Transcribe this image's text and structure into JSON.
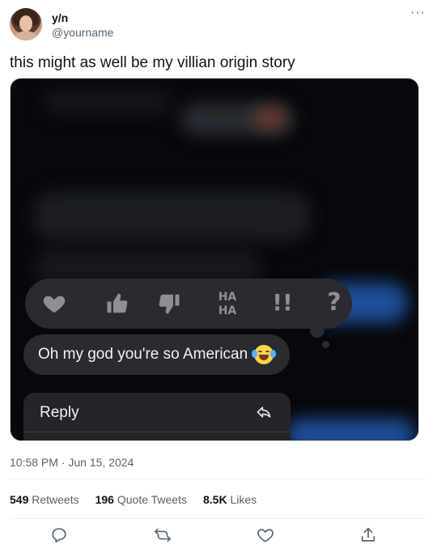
{
  "header": {
    "display_name": "y/n",
    "handle": "@yourname",
    "more_label": "···"
  },
  "tweet": {
    "text": "this might as well be my villian origin story"
  },
  "media": {
    "reactions": [
      {
        "name": "heart",
        "label": ""
      },
      {
        "name": "thumbs-up",
        "label": ""
      },
      {
        "name": "thumbs-down",
        "label": ""
      },
      {
        "name": "haha",
        "label": "HA HA"
      },
      {
        "name": "exclamation",
        "label": "!!"
      },
      {
        "name": "question",
        "label": "?"
      }
    ],
    "haha_top": "HA",
    "haha_bottom": "HA",
    "bang_label": "!!",
    "question_label": "?",
    "message": "Oh my god you're so American",
    "emoji": "face-with-tears-of-joy",
    "reply_label": "Reply",
    "colors": {
      "bubble": "#2a2b30",
      "reaction_icon": "#8e8f94",
      "imessage_blue": "#1d4e97"
    }
  },
  "timestamp": "10:58 PM · Jun 15, 2024",
  "stats": {
    "retweets_count": "549",
    "retweets_label": "Retweets",
    "quotes_count": "196",
    "quotes_label": "Quote Tweets",
    "likes_count": "8.5K",
    "likes_label": "Likes"
  },
  "actions": [
    {
      "name": "reply-icon"
    },
    {
      "name": "retweet-icon"
    },
    {
      "name": "like-icon"
    },
    {
      "name": "share-icon"
    }
  ]
}
